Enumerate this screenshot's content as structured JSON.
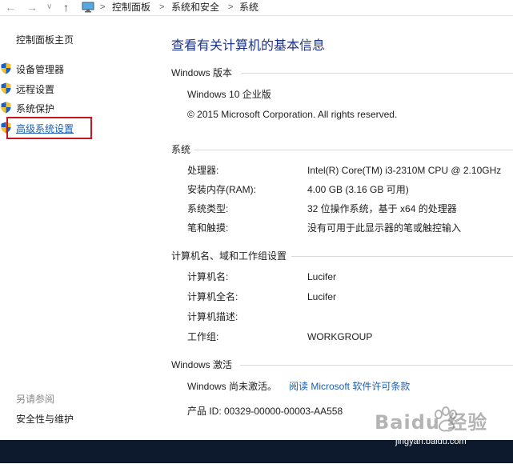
{
  "address_bar": {
    "back_icon": "arrow-left",
    "forward_icon": "arrow-right",
    "recent_icon": "chevron-down",
    "up_icon": "arrow-up",
    "location_icon": "monitor",
    "crumbs": [
      "控制面板",
      "系统和安全",
      "系统"
    ],
    "separator": ">"
  },
  "sidebar": {
    "home": "控制面板主页",
    "items": [
      {
        "label": "设备管理器",
        "icon": "shield-icon"
      },
      {
        "label": "远程设置",
        "icon": "shield-icon"
      },
      {
        "label": "系统保护",
        "icon": "shield-icon"
      },
      {
        "label": "高级系统设置",
        "icon": "shield-icon",
        "highlighted": true
      }
    ],
    "see_also_title": "另请参阅",
    "see_also": [
      "安全性与维护"
    ]
  },
  "main": {
    "title": "查看有关计算机的基本信息",
    "windows_edition": {
      "title": "Windows 版本",
      "edition": "Windows 10 企业版",
      "copyright": "© 2015 Microsoft Corporation. All rights reserved."
    },
    "system": {
      "title": "系统",
      "rows": [
        {
          "label": "处理器:",
          "value": "Intel(R) Core(TM) i3-2310M CPU @ 2.10GHz"
        },
        {
          "label": "安装内存(RAM):",
          "value": "4.00 GB (3.16 GB 可用)"
        },
        {
          "label": "系统类型:",
          "value": "32 位操作系统，基于 x64 的处理器"
        },
        {
          "label": "笔和触摸:",
          "value": "没有可用于此显示器的笔或触控输入"
        }
      ]
    },
    "computer_name": {
      "title": "计算机名、域和工作组设置",
      "rows": [
        {
          "label": "计算机名:",
          "value": "Lucifer"
        },
        {
          "label": "计算机全名:",
          "value": "Lucifer"
        },
        {
          "label": "计算机描述:",
          "value": ""
        },
        {
          "label": "工作组:",
          "value": "WORKGROUP"
        }
      ]
    },
    "activation": {
      "title": "Windows 激活",
      "status": "Windows 尚未激活。",
      "license_link": "阅读 Microsoft 软件许可条款",
      "product_id": "产品 ID: 00329-00000-00003-AA558"
    }
  },
  "watermark": {
    "text": "Baidu 经验",
    "url": "jingyan.baidu.com"
  },
  "colors": {
    "title_blue": "#1e3287",
    "link_blue": "#1a5fb4",
    "highlight_red": "#c8161d",
    "taskbar": "#0d1a2d"
  }
}
